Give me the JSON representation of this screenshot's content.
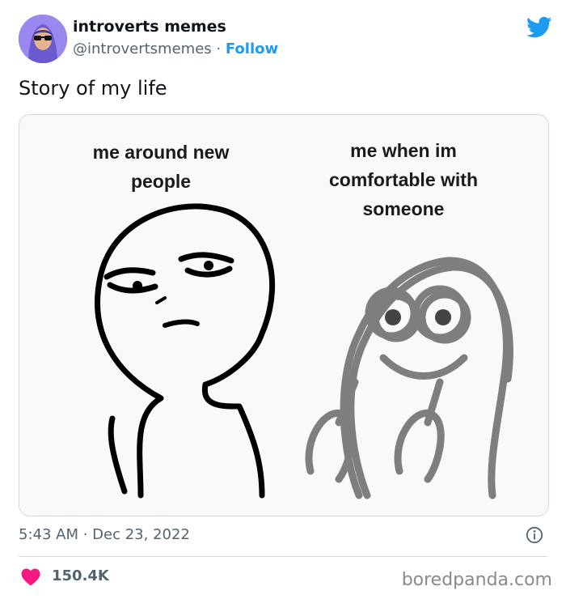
{
  "author": {
    "name": "introverts memes",
    "handle": "@introvertsmemes",
    "separator": "·",
    "follow_label": "Follow"
  },
  "tweet": {
    "text": "Story of my life",
    "timestamp": "5:43 AM · Dec 23, 2022",
    "like_count": "150.4K"
  },
  "meme": {
    "left_caption": "me around new people",
    "right_caption": "me when im comfortable with someone"
  },
  "watermark": "boredpanda.com",
  "colors": {
    "accent": "#1d9bf0",
    "heart": "#f91880",
    "secondary_text": "#536471",
    "border": "#cfd9de"
  },
  "icons": [
    "twitter-bird-icon",
    "info-icon",
    "heart-icon"
  ]
}
